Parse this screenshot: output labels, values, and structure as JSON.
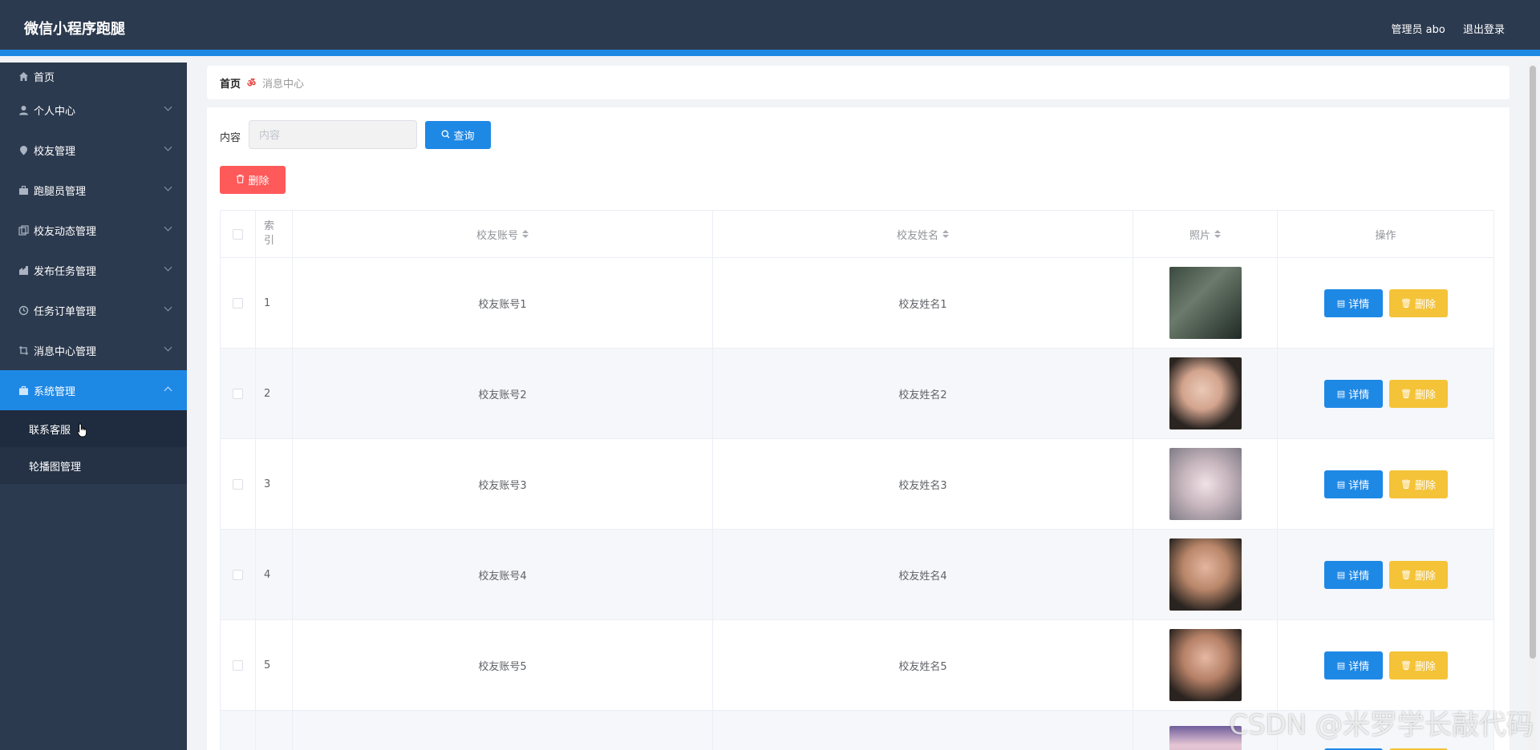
{
  "header": {
    "title": "微信小程序跑腿",
    "user_label": "管理员 abo",
    "logout_label": "退出登录"
  },
  "sidebar": {
    "items": [
      {
        "label": "首页",
        "icon": "home-icon"
      },
      {
        "label": "个人中心",
        "icon": "user-icon"
      },
      {
        "label": "校友管理",
        "icon": "location-icon"
      },
      {
        "label": "跑腿员管理",
        "icon": "briefcase-icon"
      },
      {
        "label": "校友动态管理",
        "icon": "copy-icon"
      },
      {
        "label": "发布任务管理",
        "icon": "house-icon"
      },
      {
        "label": "任务订单管理",
        "icon": "clock-icon"
      },
      {
        "label": "消息中心管理",
        "icon": "crop-icon"
      },
      {
        "label": "系统管理",
        "icon": "suitcase-icon"
      }
    ],
    "sub_items": [
      {
        "label": "联系客服"
      },
      {
        "label": "轮播图管理"
      }
    ]
  },
  "breadcrumb": {
    "home": "首页",
    "current": "消息中心"
  },
  "search": {
    "label": "内容",
    "placeholder": "内容",
    "query_label": "查询",
    "delete_label": "删除"
  },
  "table": {
    "headers": {
      "index": "索引",
      "account": "校友账号",
      "name": "校友姓名",
      "photo": "照片",
      "ops": "操作"
    },
    "rows": [
      {
        "index": "1",
        "account": "校友账号1",
        "name": "校友姓名1"
      },
      {
        "index": "2",
        "account": "校友账号2",
        "name": "校友姓名2"
      },
      {
        "index": "3",
        "account": "校友账号3",
        "name": "校友姓名3"
      },
      {
        "index": "4",
        "account": "校友账号4",
        "name": "校友姓名4"
      },
      {
        "index": "5",
        "account": "校友账号5",
        "name": "校友姓名5"
      }
    ],
    "detail_label": "详情",
    "delete_label": "删除"
  },
  "watermark": "CSDN @米罗学长敲代码",
  "colors": {
    "header_bg": "#2c3a4f",
    "accent": "#1e88e5",
    "danger": "#ff5a5a",
    "warning": "#f4c338"
  }
}
